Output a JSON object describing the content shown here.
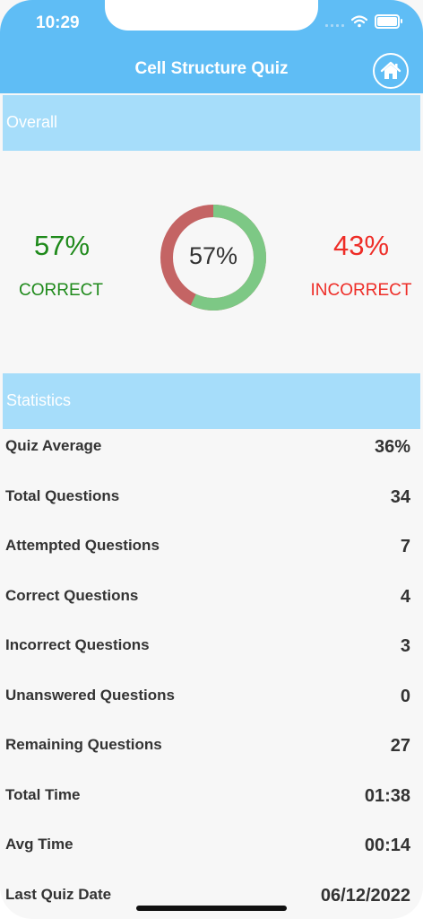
{
  "status_bar": {
    "time": "10:29"
  },
  "nav": {
    "title": "Cell Structure Quiz"
  },
  "overall": {
    "header": "Overall",
    "correct_pct": "57%",
    "correct_label": "CORRECT",
    "incorrect_pct": "43%",
    "incorrect_label": "INCORRECT",
    "donut_label": "57%",
    "correct_fraction": 0.57,
    "colors": {
      "correct": "#7dc885",
      "incorrect": "#c46464"
    }
  },
  "statistics": {
    "header": "Statistics",
    "rows": [
      {
        "label": "Quiz Average",
        "value": "36%"
      },
      {
        "label": "Total Questions",
        "value": "34"
      },
      {
        "label": "Attempted Questions",
        "value": "7"
      },
      {
        "label": "Correct Questions",
        "value": "4"
      },
      {
        "label": "Incorrect Questions",
        "value": "3"
      },
      {
        "label": "Unanswered Questions",
        "value": "0"
      },
      {
        "label": "Remaining Questions",
        "value": "27"
      },
      {
        "label": "Total Time",
        "value": "01:38"
      },
      {
        "label": "Avg Time",
        "value": "00:14"
      },
      {
        "label": "Last Quiz Date",
        "value": "06/12/2022"
      }
    ]
  },
  "icons": {
    "home": "home-icon",
    "wifi": "wifi-icon",
    "battery": "battery-icon",
    "signal": "signal-icon"
  }
}
